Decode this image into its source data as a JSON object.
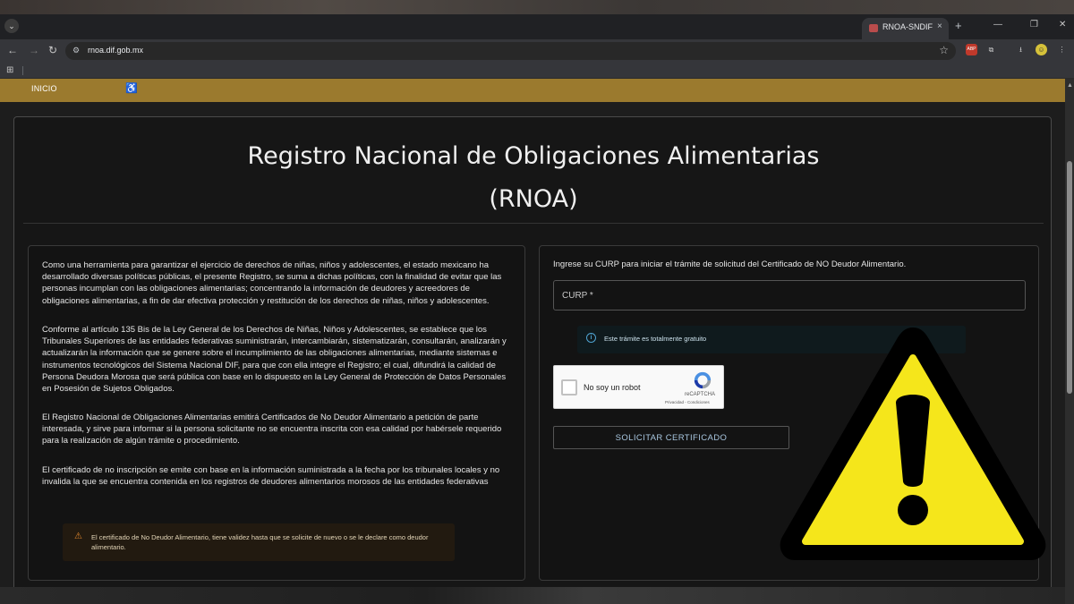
{
  "browser": {
    "tab_title": "RNOA-SNDIF",
    "tab_close": "×",
    "new_tab": "+",
    "url": "rnoa.dif.gob.mx",
    "window_controls": [
      "—",
      "❐",
      "✕"
    ],
    "extensions": [
      {
        "name": "abp-icon",
        "label": "ABP",
        "color": "#c0392b"
      },
      {
        "name": "puzzle-icon",
        "label": "⬚",
        "color": "#35363a"
      },
      {
        "name": "download-icon",
        "label": "⭳",
        "color": "#35363a"
      },
      {
        "name": "profile-avatar",
        "label": "☺",
        "color": "#d6c23a"
      },
      {
        "name": "menu-icon",
        "label": "⋮",
        "color": "#35363a"
      }
    ]
  },
  "navbar": {
    "inicio_label": "INICIO",
    "accessibility_icon": "♿",
    "bg_color": "#9b7a2e"
  },
  "main": {
    "title_line1": "Registro Nacional de Obligaciones Alimentarias",
    "title_line2": "(RNOA)",
    "paragraphs": [
      "Como una herramienta para garantizar el ejercicio de derechos de niñas, niños y adolescentes, el estado mexicano ha desarrollado diversas políticas públicas, el presente Registro, se suma a dichas políticas, con la finalidad de evitar que las personas incumplan con las obligaciones alimentarias; concentrando la información de deudores y acreedores de obligaciones alimentarias, a fin de dar efectiva protección y restitución de los derechos de niñas, niños y adolescentes.",
      "Conforme al artículo 135 Bis de la Ley General de los Derechos de Niñas, Niños y Adolescentes, se establece que los Tribunales Superiores de las entidades federativas suministrarán, intercambiarán, sistematizarán, consultarán, analizarán y actualizarán la información que se genere sobre el incumplimiento de las obligaciones alimentarias, mediante sistemas e instrumentos tecnológicos del Sistema Nacional DIF, para que con ella integre el Registro; el cual, difundirá la calidad de Persona Deudora Morosa que será pública con base en lo dispuesto en la Ley General de Protección de Datos Personales en Posesión de Sujetos Obligados.",
      "El Registro Nacional de Obligaciones Alimentarias emitirá Certificados de No Deudor Alimentario a petición de parte interesada, y sirve para informar si la persona solicitante no se encuentra inscrita con esa calidad por habérsele requerido para la realización de algún trámite o procedimiento.",
      "El certificado de no inscripción se emite con base en la información suministrada a la fecha por los tribunales locales y no invalida la que se encuentra contenida en los registros de deudores alimentarios morosos de las entidades federativas"
    ],
    "warning_text": "El certificado de No Deudor Alimentario, tiene validez hasta que se solicite de nuevo o se le declare como deudor alimentario.",
    "curp_intro": "Ingrese su CURP para iniciar el trámite de solicitud del Certificado de NO Deudor Alimentario.",
    "curp_placeholder": "CURP *",
    "info_text": "Este trámite es totalmente gratuito",
    "captcha_label": "No soy un robot",
    "captcha_brand": "reCAPTCHA",
    "captcha_links": "Privacidad - Condiciones",
    "submit_label": "SOLICITAR CERTIFICADO"
  },
  "overlay": {
    "icon": "warning-triangle",
    "color": "#f5e61b"
  }
}
